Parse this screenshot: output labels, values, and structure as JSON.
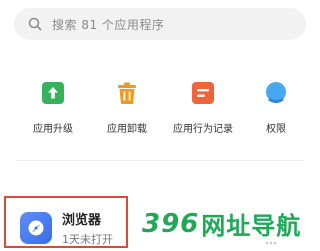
{
  "search": {
    "placeholder": "搜索 81 个应用程序",
    "icon": "search-icon"
  },
  "actions": [
    {
      "label": "应用升级",
      "icon": "upgrade-arrow-icon",
      "color": "#34b35a"
    },
    {
      "label": "应用卸载",
      "icon": "trash-icon",
      "color": "#f39a1e"
    },
    {
      "label": "应用行为记录",
      "icon": "record-list-icon",
      "color": "#f0643c"
    },
    {
      "label": "权限",
      "icon": "permission-icon",
      "color": "#47a8f0"
    }
  ],
  "app": {
    "name": "浏览器",
    "subtitle": "1天未打开",
    "icon": "browser-app-icon",
    "icon_color": "#4a7bf0",
    "highlight_color": "#d84b3a"
  },
  "watermark": {
    "digits": "396",
    "text": "网址导航",
    "color": "#1fa856"
  }
}
